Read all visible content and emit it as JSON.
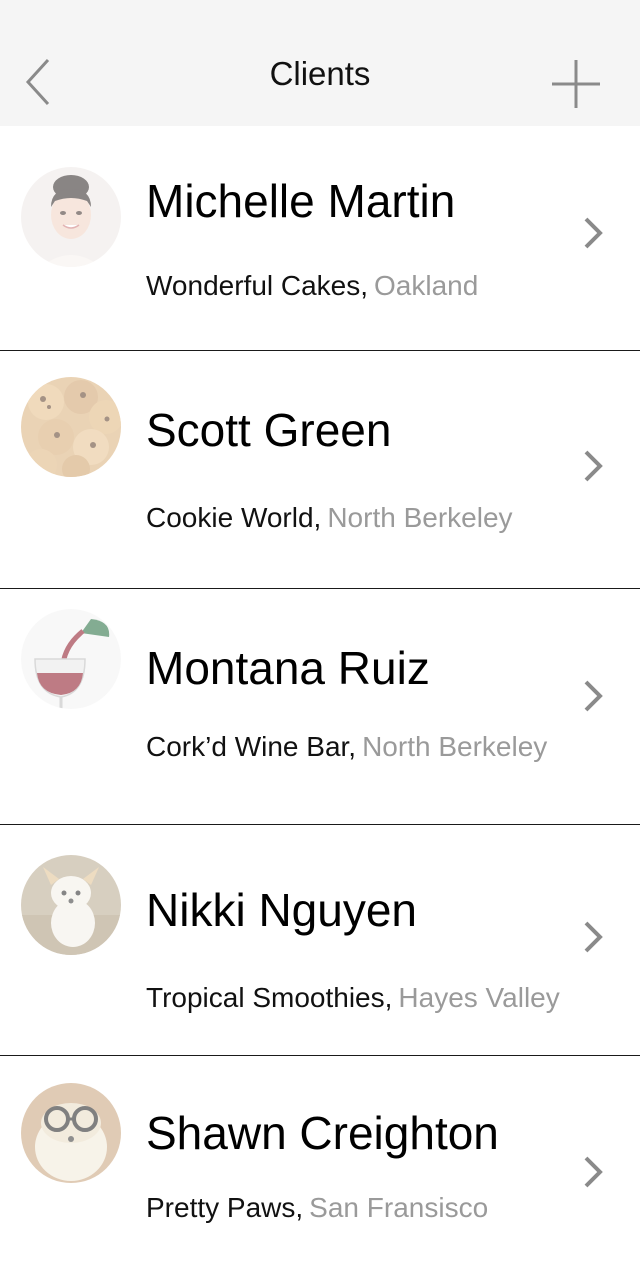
{
  "nav": {
    "title": "Clients",
    "back_icon": "chevron-left-icon",
    "add_icon": "plus-icon"
  },
  "clients": [
    {
      "name": "Michelle Martin",
      "company": "Wonderful Cakes,",
      "city": "Oakland",
      "avatar": "woman-portrait"
    },
    {
      "name": "Scott Green",
      "company": "Cookie World,",
      "city": "North Berkeley",
      "avatar": "cookies"
    },
    {
      "name": "Montana Ruiz",
      "company": "Cork’d Wine Bar,",
      "city": "North Berkeley",
      "avatar": "wine-glass"
    },
    {
      "name": "Nikki Nguyen",
      "company": "Tropical Smoothies,",
      "city": "Hayes Valley",
      "avatar": "puppy"
    },
    {
      "name": "Shawn Creighton",
      "company": "Pretty Paws,",
      "city": "San Fransisco",
      "avatar": "dog-with-glasses"
    }
  ],
  "colors": {
    "navbar_bg": "#f5f5f5",
    "city_text": "#9a9a9a",
    "chevron": "#8a8a8a",
    "separator": "#1a1a1a"
  }
}
